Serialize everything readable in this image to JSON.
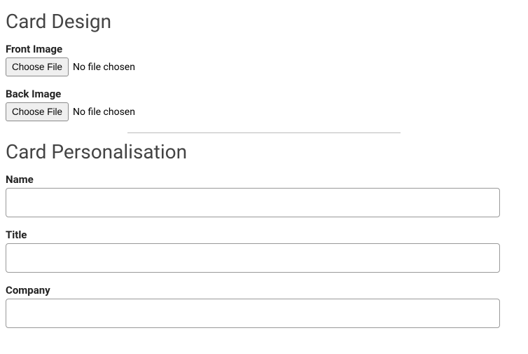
{
  "sections": {
    "design": {
      "heading": "Card Design",
      "front": {
        "label": "Front Image",
        "button": "Choose File",
        "status": "No file chosen"
      },
      "back": {
        "label": "Back Image",
        "button": "Choose File",
        "status": "No file chosen"
      }
    },
    "personalisation": {
      "heading": "Card Personalisation",
      "name": {
        "label": "Name",
        "value": ""
      },
      "title": {
        "label": "Title",
        "value": ""
      },
      "company": {
        "label": "Company",
        "value": ""
      }
    }
  }
}
